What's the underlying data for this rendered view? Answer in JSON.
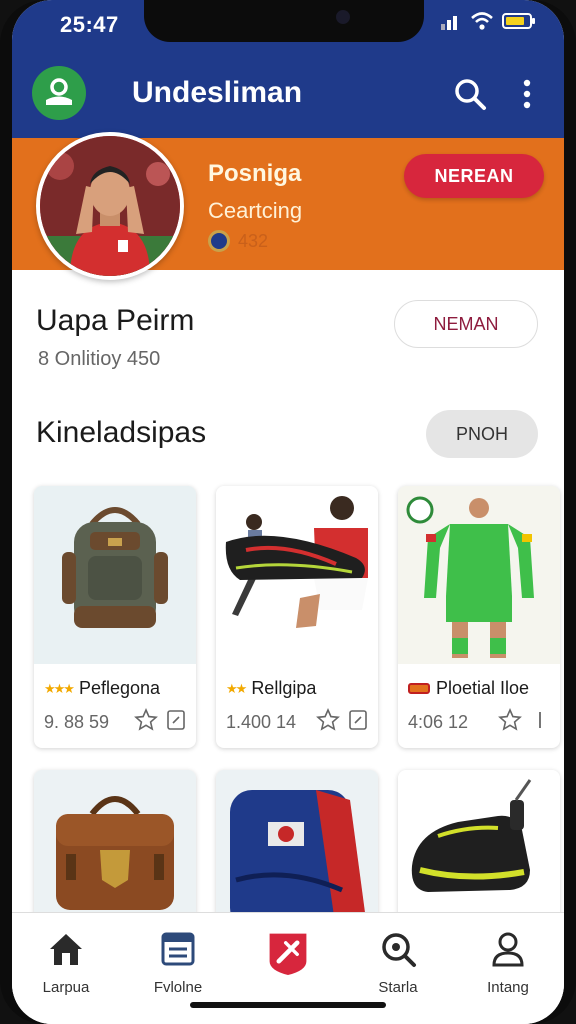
{
  "status": {
    "time": "25:47"
  },
  "app": {
    "title": "Undesliman"
  },
  "profile": {
    "name": "Posniga",
    "subtitle": "Ceartcing",
    "badge_text": "432",
    "follow_label": "NEREAN"
  },
  "user": {
    "title": "Uapa Peirm",
    "stats": "8 Onlitioy 450",
    "message_label": "NEMAN"
  },
  "section": {
    "title": "Kineladsipas",
    "button_label": "PNOH"
  },
  "products": [
    {
      "name": "Peflegona",
      "price": "9. 88 59",
      "rating_icon": "stars"
    },
    {
      "name": "Rellgipa",
      "price": "1.400 14",
      "rating_icon": "stars"
    },
    {
      "name": "Ploetial Iloe",
      "price": "4:06 12",
      "rating_icon": "tag"
    },
    {
      "name": "",
      "price": ""
    },
    {
      "name": "",
      "price": ""
    },
    {
      "name": "",
      "price": ""
    }
  ],
  "nav": [
    {
      "label": "Larpua",
      "icon": "home-icon"
    },
    {
      "label": "Fvlolne",
      "icon": "list-icon"
    },
    {
      "label": "",
      "icon": "sport-icon"
    },
    {
      "label": "Starla",
      "icon": "search-icon"
    },
    {
      "label": "Intang",
      "icon": "profile-icon"
    }
  ],
  "colors": {
    "header": "#1f3a8a",
    "banner": "#e2701c",
    "accent_red": "#d7263d",
    "logo_green": "#2e9e4a"
  }
}
